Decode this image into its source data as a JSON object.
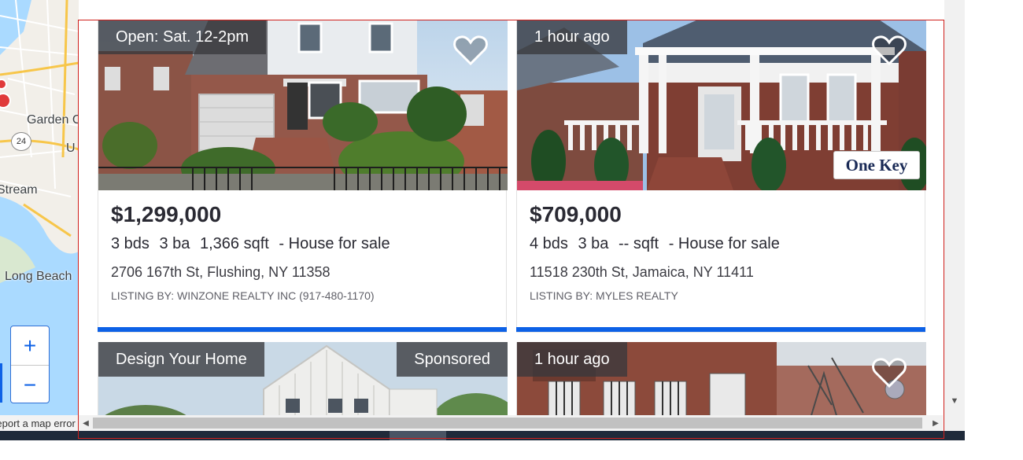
{
  "map": {
    "labels": [
      "Garden C",
      "U",
      "Stream",
      "Long Beach"
    ],
    "route_badge": "24",
    "zoom_in": "+",
    "zoom_out": "−",
    "error_link": "Report a map error"
  },
  "listings": [
    {
      "badge": "Open: Sat. 12-2pm",
      "price": "$1,299,000",
      "beds": "3 bds",
      "baths": "3 ba",
      "sqft": "1,366 sqft",
      "type": "- House for sale",
      "address": "2706 167th St, Flushing, NY 11358",
      "listing_by": "LISTING BY: WINZONE REALTY INC (917-480-1170)"
    },
    {
      "badge": "1 hour ago",
      "logo": "One Key",
      "price": "$709,000",
      "beds": "4 bds",
      "baths": "3 ba",
      "sqft": "-- sqft",
      "type": "- House for sale",
      "address": "11518 230th St, Jamaica, NY 11411",
      "listing_by": "LISTING BY: MYLES REALTY"
    },
    {
      "badge": "Design Your Home",
      "badge_right": "Sponsored"
    },
    {
      "badge": "1 hour ago"
    }
  ],
  "colors": {
    "accent": "#0d61e6",
    "focus_outline": "#d0201c",
    "badge_bg": "#38383c",
    "text": "#2a2a33"
  },
  "icons": [
    "heart-outline-icon",
    "scroll-left-icon",
    "scroll-right-icon",
    "scroll-down-icon"
  ]
}
